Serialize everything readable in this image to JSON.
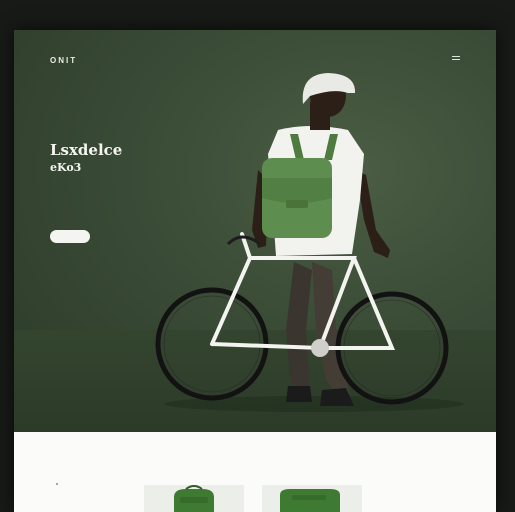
{
  "header": {
    "logo": "ONIT",
    "nav_items": [
      "",
      "",
      "",
      ""
    ]
  },
  "hero": {
    "title_line1": "Lsxdelce",
    "title_line2": "eKo3",
    "description": "",
    "cta_label": ""
  },
  "products": {
    "section_title": "",
    "section_subtitle": "",
    "section_heading": "",
    "section_label": ""
  },
  "colors": {
    "hero_green": "#3a4b36",
    "backpack_green": "#5e8e4f",
    "page_background": "#171a16"
  },
  "icons": [
    "menu-icon",
    "bicycle-illustration",
    "backpack-illustration"
  ]
}
